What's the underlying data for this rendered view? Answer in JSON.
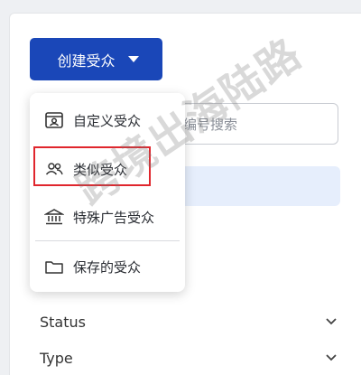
{
  "toolbar": {
    "create_label": "创建受众"
  },
  "search": {
    "placeholder_fragment": "编号搜索"
  },
  "dropdown": {
    "items": [
      {
        "label": "自定义受众",
        "icon": "portrait-card-icon"
      },
      {
        "label": "类似受众",
        "icon": "users-icon"
      },
      {
        "label": "特殊广告受众",
        "icon": "bank-icon"
      },
      {
        "label": "保存的受众",
        "icon": "folder-icon"
      }
    ]
  },
  "filters": [
    {
      "label": "Status"
    },
    {
      "label": "Type"
    }
  ],
  "watermark": "跨境出海陆路",
  "colors": {
    "primary": "#1a47b8",
    "highlight": "#e0262d"
  }
}
